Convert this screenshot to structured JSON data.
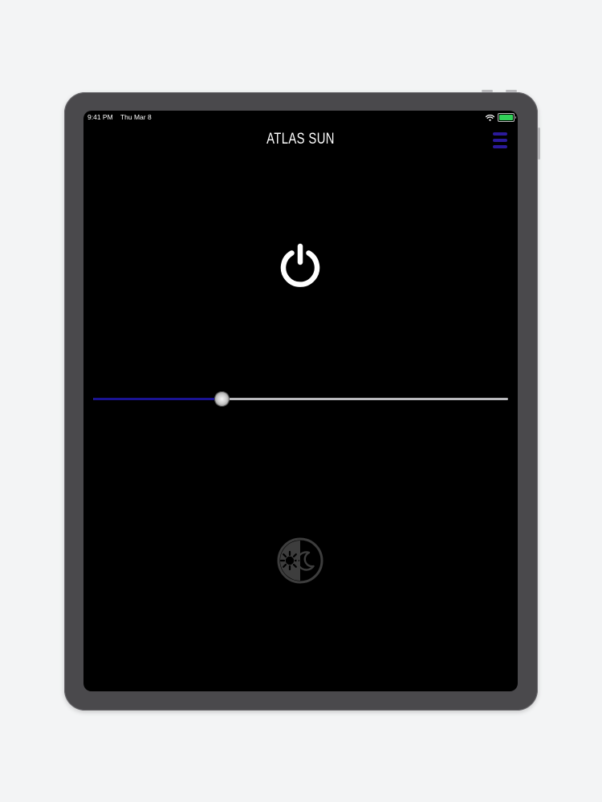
{
  "status_bar": {
    "time": "9:41 PM",
    "date": "Thu Mar 8",
    "wifi_icon": "wifi-icon",
    "battery_icon": "battery-icon",
    "battery_color": "#31d158"
  },
  "app": {
    "title": "ATLAS SUN",
    "accent_color": "#2b1a9a"
  },
  "menu": {
    "icon": "hamburger-menu-icon"
  },
  "power": {
    "icon": "power-icon"
  },
  "brightness_slider": {
    "value_percent": 31,
    "fill_color": "#1a1393"
  },
  "mode_toggle": {
    "icon": "day-night-icon"
  }
}
